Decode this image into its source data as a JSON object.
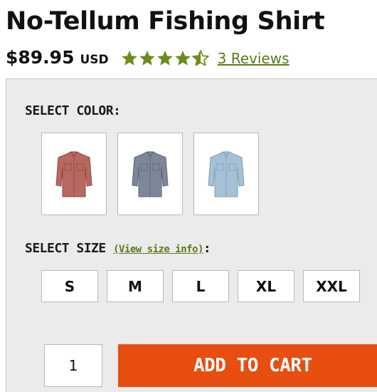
{
  "product": {
    "title": "No-Tellum Fishing Shirt",
    "price": "$89.95",
    "currency": "USD",
    "rating": 4.5,
    "rating_max": 5,
    "reviews_label": "3 Reviews"
  },
  "colors": {
    "label": "SELECT COLOR:",
    "swatches": [
      {
        "name": "red-shirt",
        "shirt": "#b8695f",
        "shade": "#8c4a43"
      },
      {
        "name": "slate-shirt",
        "shirt": "#7c8799",
        "shade": "#5a6475"
      },
      {
        "name": "light-blue-shirt",
        "shirt": "#a6c1d6",
        "shade": "#7f9db4"
      }
    ]
  },
  "sizes": {
    "label": "SELECT SIZE",
    "info_link": "(View size info)",
    "suffix": ":",
    "options": [
      "S",
      "M",
      "L",
      "XL",
      "XXL"
    ]
  },
  "cart": {
    "quantity": "1",
    "button_label": "ADD TO CART"
  },
  "theme": {
    "star_color": "#6e8c1e",
    "link_color": "#5b7a1a",
    "cart_color": "#e84e0f"
  }
}
